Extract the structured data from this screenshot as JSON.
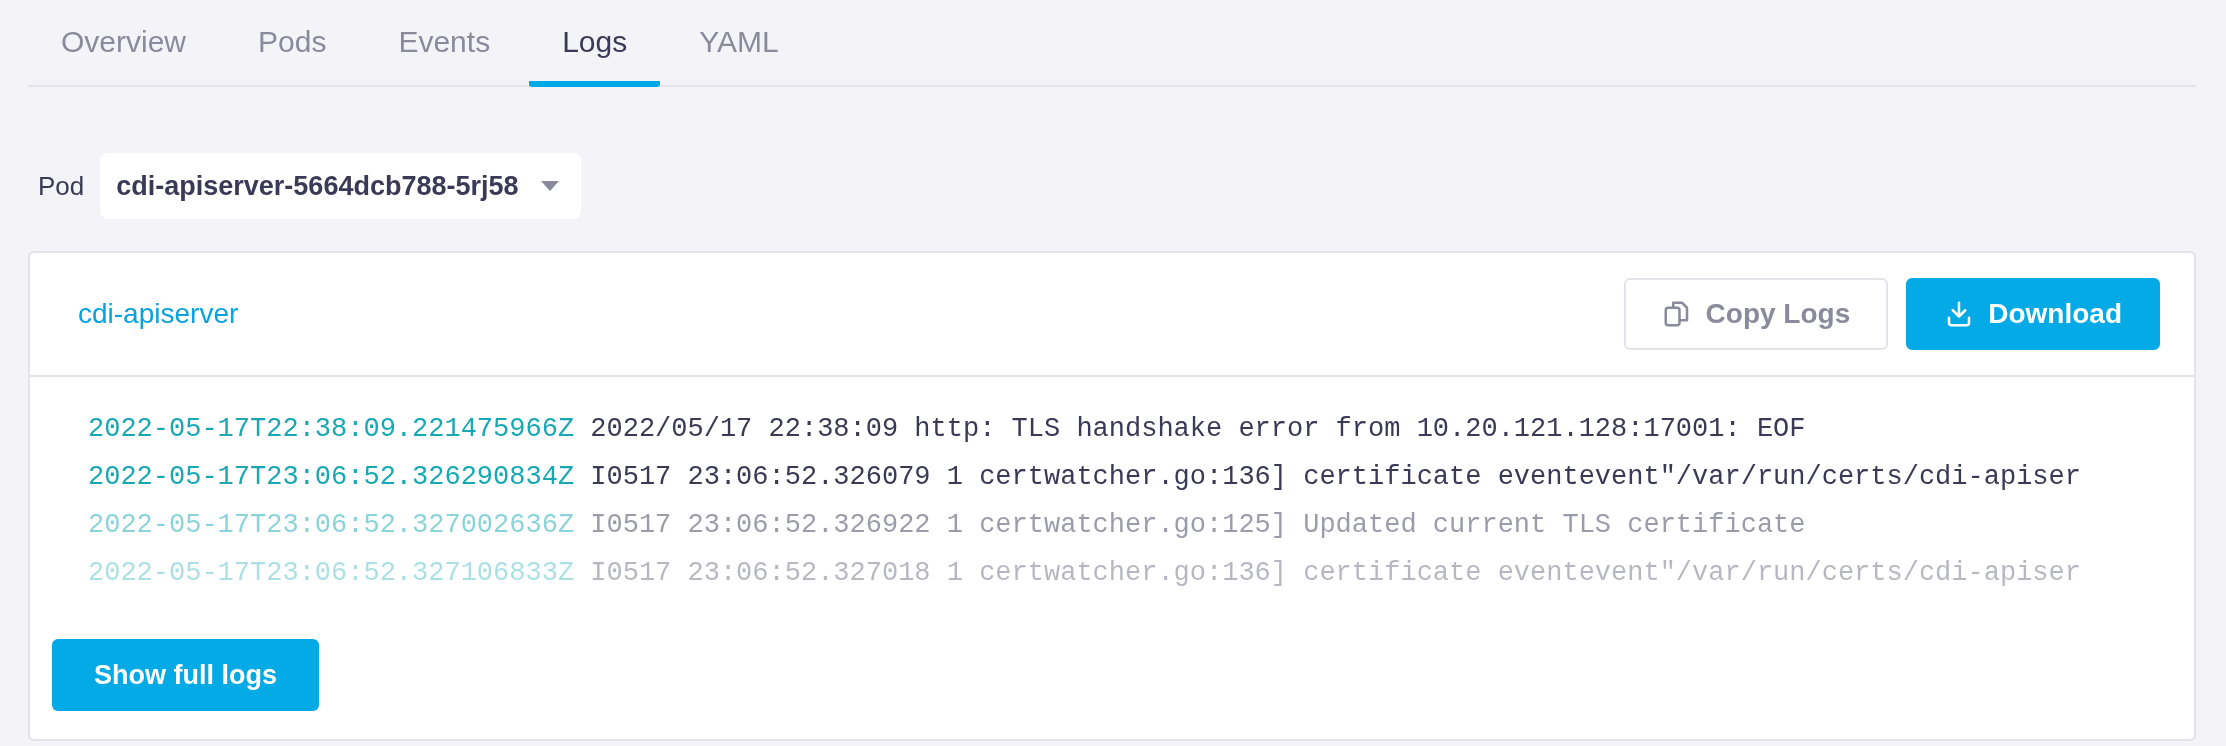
{
  "tabs": [
    {
      "label": "Overview",
      "selected": false
    },
    {
      "label": "Pods",
      "selected": false
    },
    {
      "label": "Events",
      "selected": false
    },
    {
      "label": "Logs",
      "selected": true
    },
    {
      "label": "YAML",
      "selected": false
    }
  ],
  "pod_selector": {
    "label": "Pod",
    "value": "cdi-apiserver-5664dcb788-5rj58"
  },
  "log_panel": {
    "title": "cdi-apiserver",
    "buttons": [
      {
        "label": "Copy Logs",
        "kind": "secondary"
      },
      {
        "label": "Download",
        "kind": "primary"
      }
    ],
    "lines": [
      {
        "timestamp": "2022-05-17T22:38:09.221475966Z",
        "message": "2022/05/17 22:38:09 http: TLS handshake error from 10.20.121.128:17001: EOF",
        "kind": "normal"
      },
      {
        "timestamp": "2022-05-17T23:06:52.326290834Z",
        "message": "I0517 23:06:52.326079 1 certwatcher.go:136] certificate eventevent\"/var/run/certs/cdi-apiser",
        "kind": "normal"
      },
      {
        "timestamp": "2022-05-17T23:06:52.327002636Z",
        "message": "I0517 23:06:52.326922 1 certwatcher.go:125] Updated current TLS certificate",
        "kind": "dim"
      },
      {
        "timestamp": "2022-05-17T23:06:52.327106833Z",
        "message": "I0517 23:06:52.327018 1 certwatcher.go:136] certificate eventevent\"/var/run/certs/cdi-apiser",
        "kind": "faint"
      }
    ],
    "show_full_button": "Show full logs"
  }
}
